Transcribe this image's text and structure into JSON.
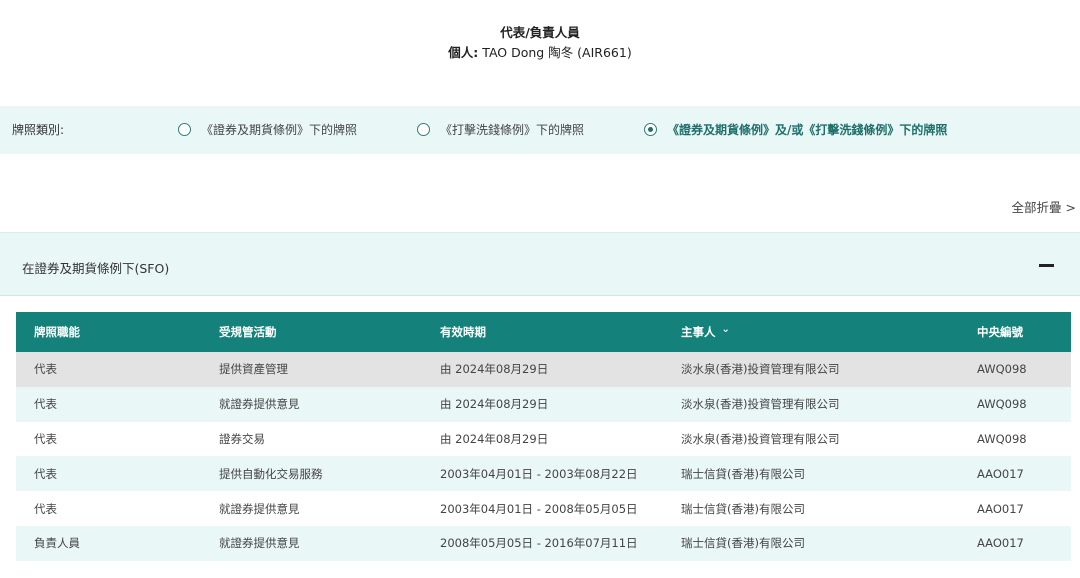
{
  "header": {
    "role": "代表/負責人員",
    "person_prefix": "個人:",
    "person_name": "TAO Dong 陶冬 (AIR661)"
  },
  "licence_type": {
    "label": "牌照類別:",
    "options": [
      {
        "label": "《證券及期貨條例》下的牌照",
        "selected": false
      },
      {
        "label": "《打擊洗錢條例》下的牌照",
        "selected": false
      },
      {
        "label": "《證券及期貨條例》及/或《打擊洗錢條例》下的牌照",
        "selected": true
      }
    ]
  },
  "collapse_all": "全部折疊 >",
  "section": {
    "title": "在證券及期貨條例下(SFO)",
    "columns": [
      "牌照職能",
      "受規管活動",
      "有效時期",
      "主事人",
      "中央編號"
    ],
    "rows": [
      [
        "代表",
        "提供資產管理",
        "由 2024年08月29日",
        "淡水泉(香港)投資管理有限公司",
        "AWQ098"
      ],
      [
        "代表",
        "就證券提供意見",
        "由 2024年08月29日",
        "淡水泉(香港)投資管理有限公司",
        "AWQ098"
      ],
      [
        "代表",
        "證券交易",
        "由 2024年08月29日",
        "淡水泉(香港)投資管理有限公司",
        "AWQ098"
      ],
      [
        "代表",
        "提供自動化交易服務",
        "2003年04月01日 - 2003年08月22日",
        "瑞士信貸(香港)有限公司",
        "AAO017"
      ],
      [
        "代表",
        "就證券提供意見",
        "2003年04月01日 - 2008年05月05日",
        "瑞士信貸(香港)有限公司",
        "AAO017"
      ],
      [
        "負責人員",
        "就證券提供意見",
        "2008年05月05日 - 2016年07月11日",
        "瑞士信貸(香港)有限公司",
        "AAO017"
      ]
    ]
  },
  "colors": {
    "accent": "#14827a",
    "light_band": "#e9f7f6",
    "hover_row": "#e3e3e3"
  }
}
